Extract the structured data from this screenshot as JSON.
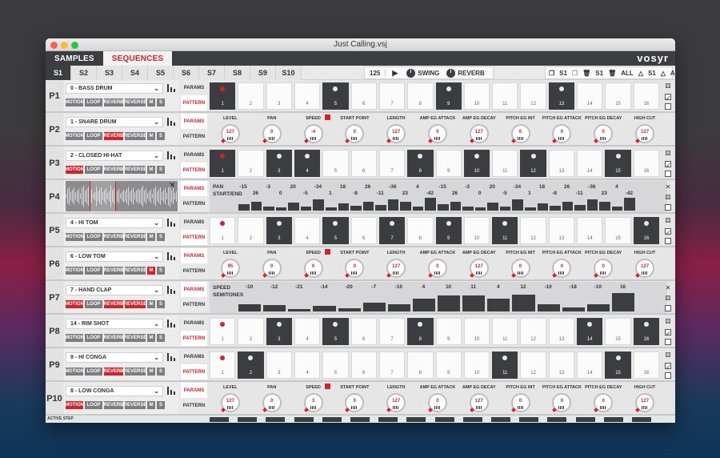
{
  "window": {
    "title": "Just Calling.vsj"
  },
  "nav": {
    "tabs": [
      "SAMPLES",
      "SEQUENCES"
    ],
    "active": 1,
    "logo": "vosyr"
  },
  "sequences": [
    "S1",
    "S2",
    "S3",
    "S4",
    "S5",
    "S6",
    "S7",
    "S8",
    "S9",
    "S10"
  ],
  "transport": {
    "tempo": "125",
    "swing": "SWING",
    "reverb": "REVERB",
    "copy": "S1",
    "clear": "S1",
    "clear_all": "ALL",
    "hat": "S1",
    "hat_all": "ALL"
  },
  "sample_buttons": [
    "MOTION",
    "LOOP",
    "REVERB",
    "REVERSE",
    "M",
    "S"
  ],
  "tabs_pp": [
    "PARAMS",
    "PATTERN"
  ],
  "param_labels": [
    "LEVEL",
    "PAN",
    "SPEED",
    "START POINT",
    "LENGTH",
    "AMP EG ATTACK",
    "AMP EG DECAY",
    "PITCH EG INT",
    "PITCH EG ATTACK",
    "PITCH EG DECAY",
    "HIGH CUT"
  ],
  "steps": [
    "1",
    "2",
    "3",
    "4",
    "5",
    "6",
    "7",
    "8",
    "9",
    "10",
    "11",
    "12",
    "13",
    "14",
    "15",
    "16"
  ],
  "rows": [
    {
      "label": "P1",
      "sample": "0 - BASS DRUM",
      "on": [],
      "view": "pattern",
      "active": [
        1,
        5,
        9,
        13
      ]
    },
    {
      "label": "P2",
      "sample": "1 - SNARE DRUM",
      "on": [
        2
      ],
      "view": "params",
      "values": [
        "127",
        "0",
        "-4",
        "0",
        "127",
        "0",
        "127",
        "0",
        "0",
        "0",
        "127"
      ]
    },
    {
      "label": "P3",
      "sample": "2 - CLOSED HI-HAT",
      "on": [
        0
      ],
      "view": "pattern",
      "active": [
        1,
        3,
        4,
        8,
        10,
        12,
        15
      ]
    },
    {
      "label": "P4",
      "sample": "",
      "on": [],
      "view": "pan",
      "pan_label": "PAN",
      "pan_label2": "START/END",
      "pan_values": [
        "-15",
        "26",
        "-3",
        "0",
        "20",
        "-5",
        "-34",
        "1",
        "18",
        "-8",
        "26",
        "-11",
        "-36",
        "23",
        "4",
        "-42",
        "-15",
        "26",
        "-3",
        "0",
        "20",
        "-5",
        "-34",
        "1",
        "18",
        "-8",
        "26",
        "-11",
        "-36",
        "23",
        "4",
        "-42"
      ]
    },
    {
      "label": "P5",
      "sample": "4 - HI TOM",
      "on": [],
      "view": "pattern",
      "active": [
        3,
        5,
        7,
        9,
        11,
        16
      ]
    },
    {
      "label": "P6",
      "sample": "6 - LOW TOM",
      "on": [
        4
      ],
      "view": "params",
      "values": [
        "95",
        "0",
        "0",
        "0",
        "127",
        "0",
        "127",
        "0",
        "0",
        "0",
        "127"
      ]
    },
    {
      "label": "P7",
      "sample": "7 - HAND CLAP",
      "on": [
        0,
        2,
        3
      ],
      "view": "speed",
      "sp_label": "SPEED",
      "sp_label2": "SEMITONES",
      "sp_values": [
        "-10",
        "-12",
        "-21",
        "-14",
        "-20",
        "-7",
        "-10",
        "4",
        "10",
        "11",
        "4",
        "12",
        "-10",
        "-18",
        "-10",
        "16"
      ]
    },
    {
      "label": "P8",
      "sample": "14 - RIM SHOT",
      "on": [],
      "view": "pattern",
      "active": [
        3,
        5,
        8,
        14,
        16
      ]
    },
    {
      "label": "P9",
      "sample": "9 - HI CONGA",
      "on": [
        2
      ],
      "view": "pattern",
      "active": [
        2,
        11,
        15
      ]
    },
    {
      "label": "P10",
      "sample": "8 - LOW CONGA",
      "on": [
        0
      ],
      "view": "params",
      "values": [
        "127",
        "0",
        "3",
        "0",
        "127",
        "0",
        "127",
        "0",
        "0",
        "0",
        "127"
      ]
    }
  ],
  "footer": {
    "active_step": "ACTIVE STEP"
  }
}
